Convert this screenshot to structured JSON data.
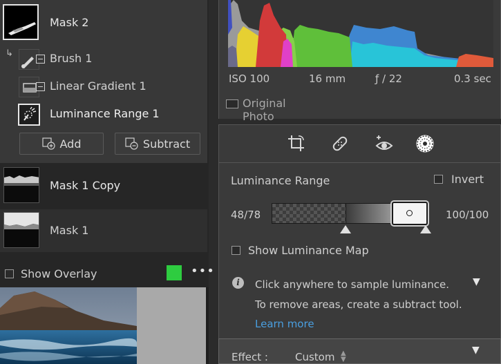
{
  "masks": {
    "mask2": {
      "label": "Mask 2"
    },
    "tools": [
      {
        "label": "Brush 1"
      },
      {
        "label": "Linear Gradient 1"
      },
      {
        "label": "Luminance Range 1"
      }
    ],
    "add_label": "Add",
    "subtract_label": "Subtract",
    "mask1copy": {
      "label": "Mask 1 Copy"
    },
    "mask1": {
      "label": "Mask 1"
    },
    "show_overlay_label": "Show Overlay",
    "overlay_color": "#2ecc40"
  },
  "histogram": {
    "iso": "ISO 100",
    "focal": "16 mm",
    "aperture": "ƒ / 22",
    "shutter": "0.3 sec",
    "original_photo_label": "Original Photo"
  },
  "luminance": {
    "title": "Luminance Range",
    "invert_label": "Invert",
    "left_value": "48/78",
    "right_value": "100/100",
    "show_map_label": "Show Luminance Map",
    "info_text": "Click anywhere to sample luminance. To remove areas, create a subtract tool.",
    "learn_more": "Learn more",
    "link_color": "#4a9fe0"
  },
  "effect": {
    "label": "Effect :",
    "value": "Custom"
  }
}
